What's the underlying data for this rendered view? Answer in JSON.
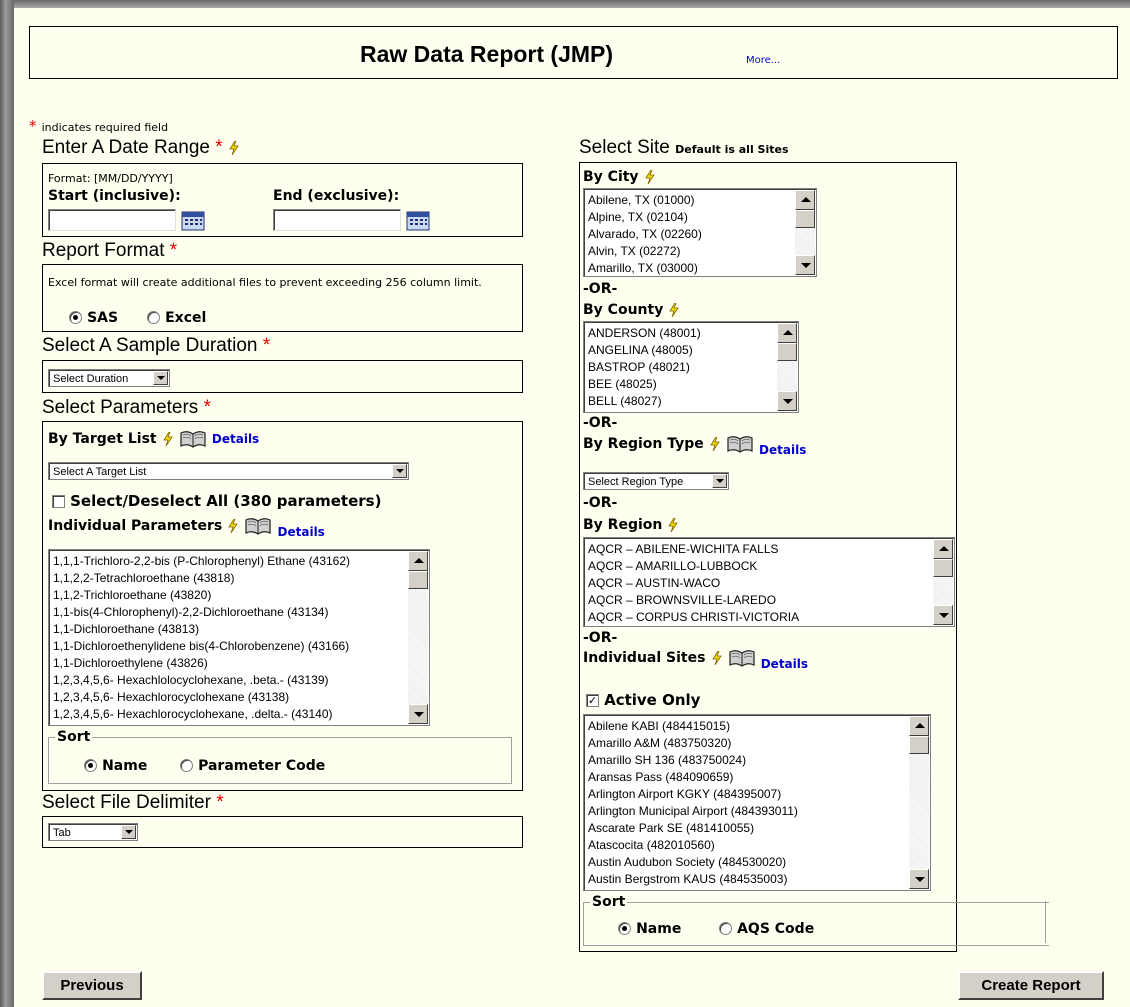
{
  "header": {
    "title": "Raw Data Report (JMP)",
    "more_link": "More..."
  },
  "required_note": {
    "star": "*",
    "text": "indicates required field"
  },
  "date_range": {
    "title": "Enter A Date Range",
    "format_text": "Format: [MM/DD/YYYY]",
    "start_label": "Start (inclusive):",
    "end_label": "End (exclusive):",
    "start_value": "",
    "end_value": ""
  },
  "report_format": {
    "title": "Report Format",
    "note": "Excel format will create additional files to prevent exceeding 256 column limit.",
    "options": [
      "SAS",
      "Excel"
    ],
    "selected": "SAS"
  },
  "sample_duration": {
    "title": "Select A Sample Duration",
    "selected": "Select Duration"
  },
  "parameters": {
    "title": "Select Parameters",
    "target_list_label": "By Target List",
    "details": "Details",
    "target_list_selected": "Select A Target List",
    "select_all_label": "Select/Deselect All (380 parameters)",
    "individual_label": "Individual Parameters",
    "items": [
      "1,1,1-Trichloro-2,2-bis (P-Chlorophenyl) Ethane (43162)",
      "1,1,2,2-Tetrachloroethane (43818)",
      "1,1,2-Trichloroethane (43820)",
      "1,1-bis(4-Chlorophenyl)-2,2-Dichloroethane (43134)",
      "1,1-Dichloroethane (43813)",
      "1,1-Dichloroethenylidene bis(4-Chlorobenzene) (43166)",
      "1,1-Dichloroethylene (43826)",
      "1,2,3,4,5,6- Hexachlolocyclohexane, .beta.- (43139)",
      "1,2,3,4,5,6- Hexachlorocyclohexane (43138)",
      "1,2,3,4,5,6- Hexachlorocyclohexane, .delta.- (43140)"
    ],
    "sort_legend": "Sort",
    "sort_options": [
      "Name",
      "Parameter Code"
    ],
    "sort_selected": "Name"
  },
  "delimiter": {
    "title": "Select File Delimiter",
    "selected": "Tab"
  },
  "site": {
    "title": "Select Site",
    "default_note": "Default is all Sites",
    "or": "-OR-",
    "by_city": "By City",
    "cities": [
      "Abilene, TX (01000)",
      "Alpine, TX (02104)",
      "Alvarado, TX (02260)",
      "Alvin, TX (02272)",
      "Amarillo, TX (03000)"
    ],
    "by_county": "By County",
    "counties": [
      "ANDERSON (48001)",
      "ANGELINA (48005)",
      "BASTROP (48021)",
      "BEE (48025)",
      "BELL (48027)"
    ],
    "by_region_type": "By Region Type",
    "details": "Details",
    "region_type_selected": "Select Region Type",
    "by_region": "By Region",
    "regions": [
      "AQCR – ABILENE-WICHITA FALLS",
      "AQCR – AMARILLO-LUBBOCK",
      "AQCR – AUSTIN-WACO",
      "AQCR – BROWNSVILLE-LAREDO",
      "AQCR – CORPUS CHRISTI-VICTORIA"
    ],
    "individual_sites": "Individual Sites",
    "active_only_label": "Active Only",
    "active_only_checked": true,
    "sites": [
      "Abilene KABI (484415015)",
      "Amarillo A&M (483750320)",
      "Amarillo SH 136 (483750024)",
      "Aransas Pass (484090659)",
      "Arlington Airport KGKY (484395007)",
      "Arlington Municipal Airport (484393011)",
      "Ascarate Park SE (481410055)",
      "Atascocita (482010560)",
      "Austin Audubon Society (484530020)",
      "Austin Bergstrom KAUS (484535003)"
    ],
    "sort_legend": "Sort",
    "sort_options": [
      "Name",
      "AQS Code"
    ],
    "sort_selected": "Name"
  },
  "buttons": {
    "previous": "Previous",
    "create_report": "Create Report"
  },
  "colors": {
    "background": "#fffff0",
    "required": "#e00000",
    "link": "#0000cc",
    "bolt": "#f0e000"
  }
}
